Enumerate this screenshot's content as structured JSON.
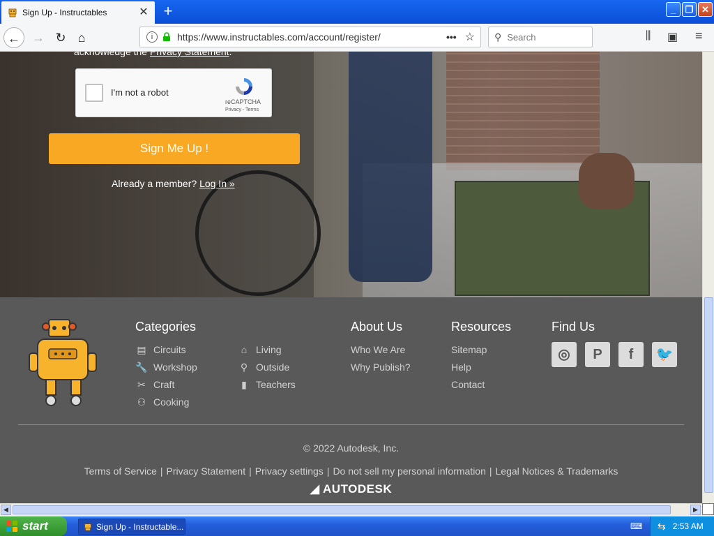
{
  "browser": {
    "tab_title": "Sign Up - Instructables",
    "new_tab": "+",
    "url": "https://www.instructables.com/account/register/",
    "search_placeholder": "Search",
    "window_min": "_",
    "window_max": "❐",
    "window_close": "✕"
  },
  "page": {
    "cut_text_prefix": "acknowledge the ",
    "cut_text_link": "Privacy Statement",
    "cut_text_suffix": ".",
    "captcha": {
      "label": "I'm not a robot",
      "brand": "reCAPTCHA",
      "links": "Privacy - Terms"
    },
    "signup_button": "Sign Me Up !",
    "already_member": "Already a member? ",
    "login_link": "Log In »"
  },
  "footer": {
    "categories_title": "Categories",
    "categories": [
      {
        "label": "Circuits",
        "icon": "circuits-icon"
      },
      {
        "label": "Workshop",
        "icon": "wrench-icon"
      },
      {
        "label": "Craft",
        "icon": "scissors-icon"
      },
      {
        "label": "Cooking",
        "icon": "cooking-icon"
      },
      {
        "label": "Living",
        "icon": "house-icon"
      },
      {
        "label": "Outside",
        "icon": "bicycle-icon"
      },
      {
        "label": "Teachers",
        "icon": "book-icon"
      }
    ],
    "about_title": "About Us",
    "about": [
      "Who We Are",
      "Why Publish?"
    ],
    "resources_title": "Resources",
    "resources": [
      "Sitemap",
      "Help",
      "Contact"
    ],
    "find_us_title": "Find Us",
    "social": [
      "instagram-icon",
      "pinterest-icon",
      "facebook-icon",
      "twitter-icon"
    ],
    "copyright": "© 2022 Autodesk, Inc.",
    "legal": [
      "Terms of Service",
      "Privacy Statement",
      "Privacy settings",
      "Do not sell my personal information",
      "Legal Notices & Trademarks"
    ],
    "brand": "AUTODESK"
  },
  "taskbar": {
    "start": "start",
    "task_item": "Sign Up - Instructable...",
    "clock": "2:53 AM"
  },
  "colors": {
    "accent_orange": "#f9a824",
    "footer_bg": "#595959",
    "xp_blue": "#245edb"
  }
}
